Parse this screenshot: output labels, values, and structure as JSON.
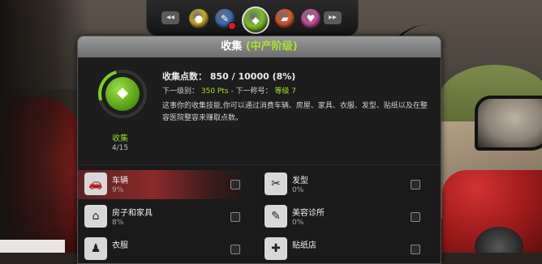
{
  "tabs": [
    {
      "icon": "coin-icon",
      "glyph": "●",
      "color": "#c9a62a"
    },
    {
      "icon": "tools-icon",
      "glyph": "✎",
      "color": "#3d6cb8",
      "alert": true
    },
    {
      "icon": "diamond-icon",
      "glyph": "◆",
      "color": "#7dbf2a",
      "active": true
    },
    {
      "icon": "car-icon",
      "glyph": "▰",
      "color": "#d4572c"
    },
    {
      "icon": "heart-icon",
      "glyph": "♥",
      "color": "#c0509a"
    }
  ],
  "panel": {
    "title": "收集",
    "subtitle": "(中产阶级)"
  },
  "summary": {
    "ring_label": "收集",
    "ring_count": "4/15",
    "points_label": "收集点数：",
    "points_value": "850 / 10000 (8%)",
    "next_level_label": "下一级别：",
    "next_level_value": "350 Pts",
    "next_title_label": "- 下一称号：",
    "next_title_value": "等级 7",
    "description": "这事你的收集技能,你可以通过消费车辆、房屋、家具、衣服、发型、贴纸以及在整容医院整容来赚取点数。",
    "progress": 0.08
  },
  "categories": [
    {
      "name": "车辆",
      "pct": "9%",
      "icon": "car-icon",
      "glyph": "🚗",
      "highlight": true
    },
    {
      "name": "发型",
      "pct": "0%",
      "icon": "scissors-icon",
      "glyph": "✂",
      "highlight": false
    },
    {
      "name": "房子和家具",
      "pct": "8%",
      "icon": "house-icon",
      "glyph": "⌂",
      "highlight": false
    },
    {
      "name": "美容诊所",
      "pct": "0%",
      "icon": "syringe-icon",
      "glyph": "✎",
      "highlight": false
    },
    {
      "name": "衣服",
      "pct": "",
      "icon": "clothes-icon",
      "glyph": "♟",
      "highlight": false
    },
    {
      "name": "贴纸店",
      "pct": "",
      "icon": "sticker-icon",
      "glyph": "✚",
      "highlight": false
    }
  ]
}
